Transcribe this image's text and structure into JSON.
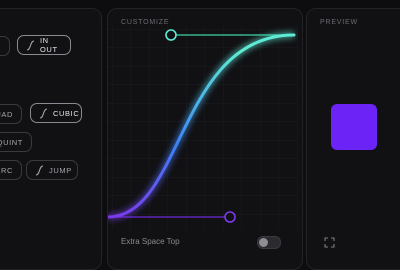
{
  "panels": {
    "customize_title": "CUSTOMIZE",
    "preview_title": "PREVIEW"
  },
  "easings": {
    "in_out": "IN OUT",
    "quad": "QUAD",
    "cubic": "CUBIC",
    "quint": "QUINT",
    "circ": "CIRC",
    "jump": "JUMP"
  },
  "controls": {
    "extra_space_top_label": "Extra Space Top",
    "extra_space_top_enabled": false
  },
  "colors": {
    "curve_start": "#7c3aed",
    "curve_end": "#5eead4",
    "preview_box": "#6b24f5"
  },
  "icons": {
    "curve": "easing-curve-icon",
    "fullscreen": "fullscreen-icon"
  }
}
